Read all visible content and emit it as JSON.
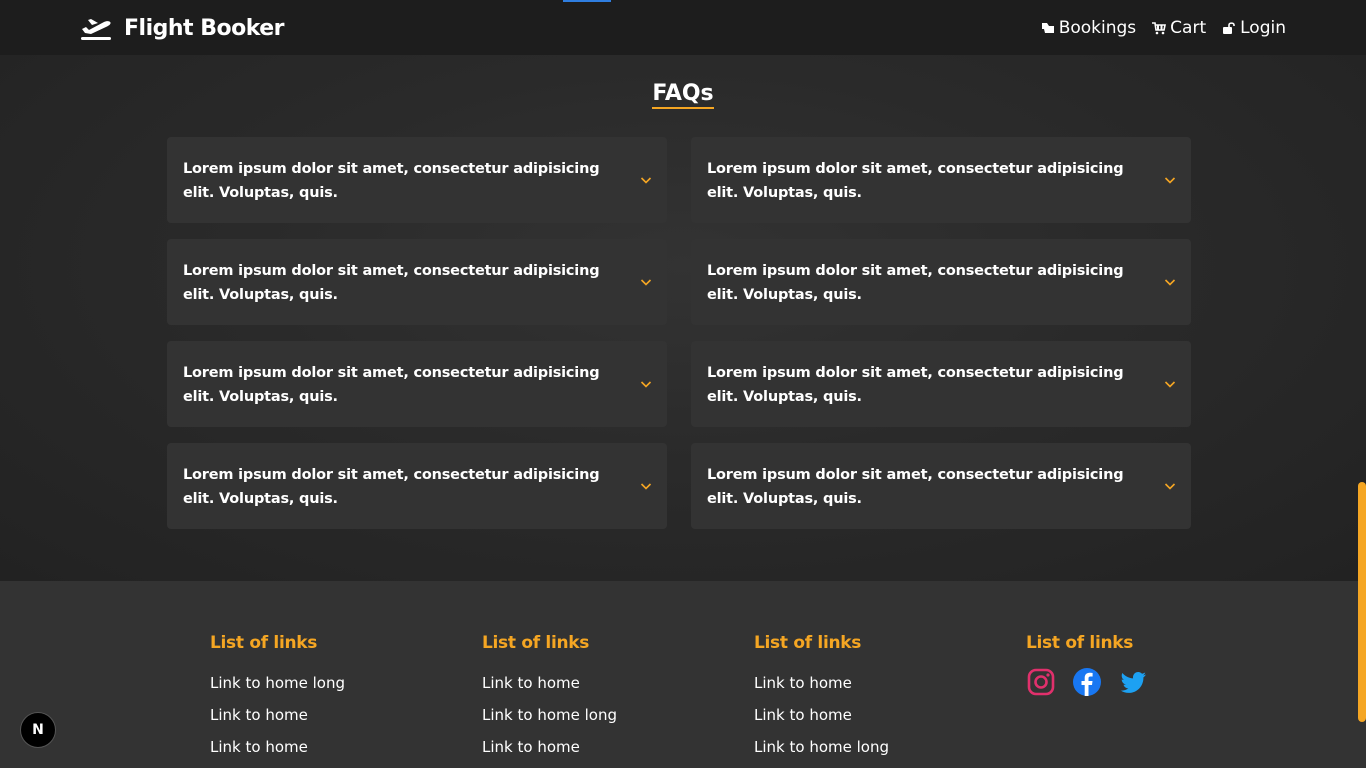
{
  "header": {
    "brand": "Flight Booker",
    "nav": [
      {
        "label": "Bookings",
        "icon": "bookings-icon"
      },
      {
        "label": "Cart",
        "icon": "cart-icon"
      },
      {
        "label": "Login",
        "icon": "unlock-icon"
      }
    ]
  },
  "faq": {
    "title": "FAQs",
    "items": [
      {
        "question": "Lorem ipsum dolor sit amet, consectetur adipisicing elit. Voluptas, quis."
      },
      {
        "question": "Lorem ipsum dolor sit amet, consectetur adipisicing elit. Voluptas, quis."
      },
      {
        "question": "Lorem ipsum dolor sit amet, consectetur adipisicing elit. Voluptas, quis."
      },
      {
        "question": "Lorem ipsum dolor sit amet, consectetur adipisicing elit. Voluptas, quis."
      },
      {
        "question": "Lorem ipsum dolor sit amet, consectetur adipisicing elit. Voluptas, quis."
      },
      {
        "question": "Lorem ipsum dolor sit amet, consectetur adipisicing elit. Voluptas, quis."
      },
      {
        "question": "Lorem ipsum dolor sit amet, consectetur adipisicing elit. Voluptas, quis."
      },
      {
        "question": "Lorem ipsum dolor sit amet, consectetur adipisicing elit. Voluptas, quis."
      }
    ]
  },
  "footer": {
    "columns": [
      {
        "heading": "List of links",
        "links": [
          "Link to home long",
          "Link to home",
          "Link to home"
        ]
      },
      {
        "heading": "List of links",
        "links": [
          "Link to home",
          "Link to home long",
          "Link to home"
        ]
      },
      {
        "heading": "List of links",
        "links": [
          "Link to home",
          "Link to home",
          "Link to home long"
        ]
      },
      {
        "heading": "List of links",
        "socials": [
          "instagram-icon",
          "facebook-icon",
          "twitter-icon"
        ]
      }
    ]
  },
  "badge": {
    "label": "N"
  },
  "colors": {
    "accent": "#f5a623",
    "header_bg": "#1d1d1d",
    "card_bg": "#333333",
    "footer_bg": "#333333",
    "instagram": "#e1306c",
    "facebook": "#1877f2",
    "twitter": "#1da1f2"
  }
}
